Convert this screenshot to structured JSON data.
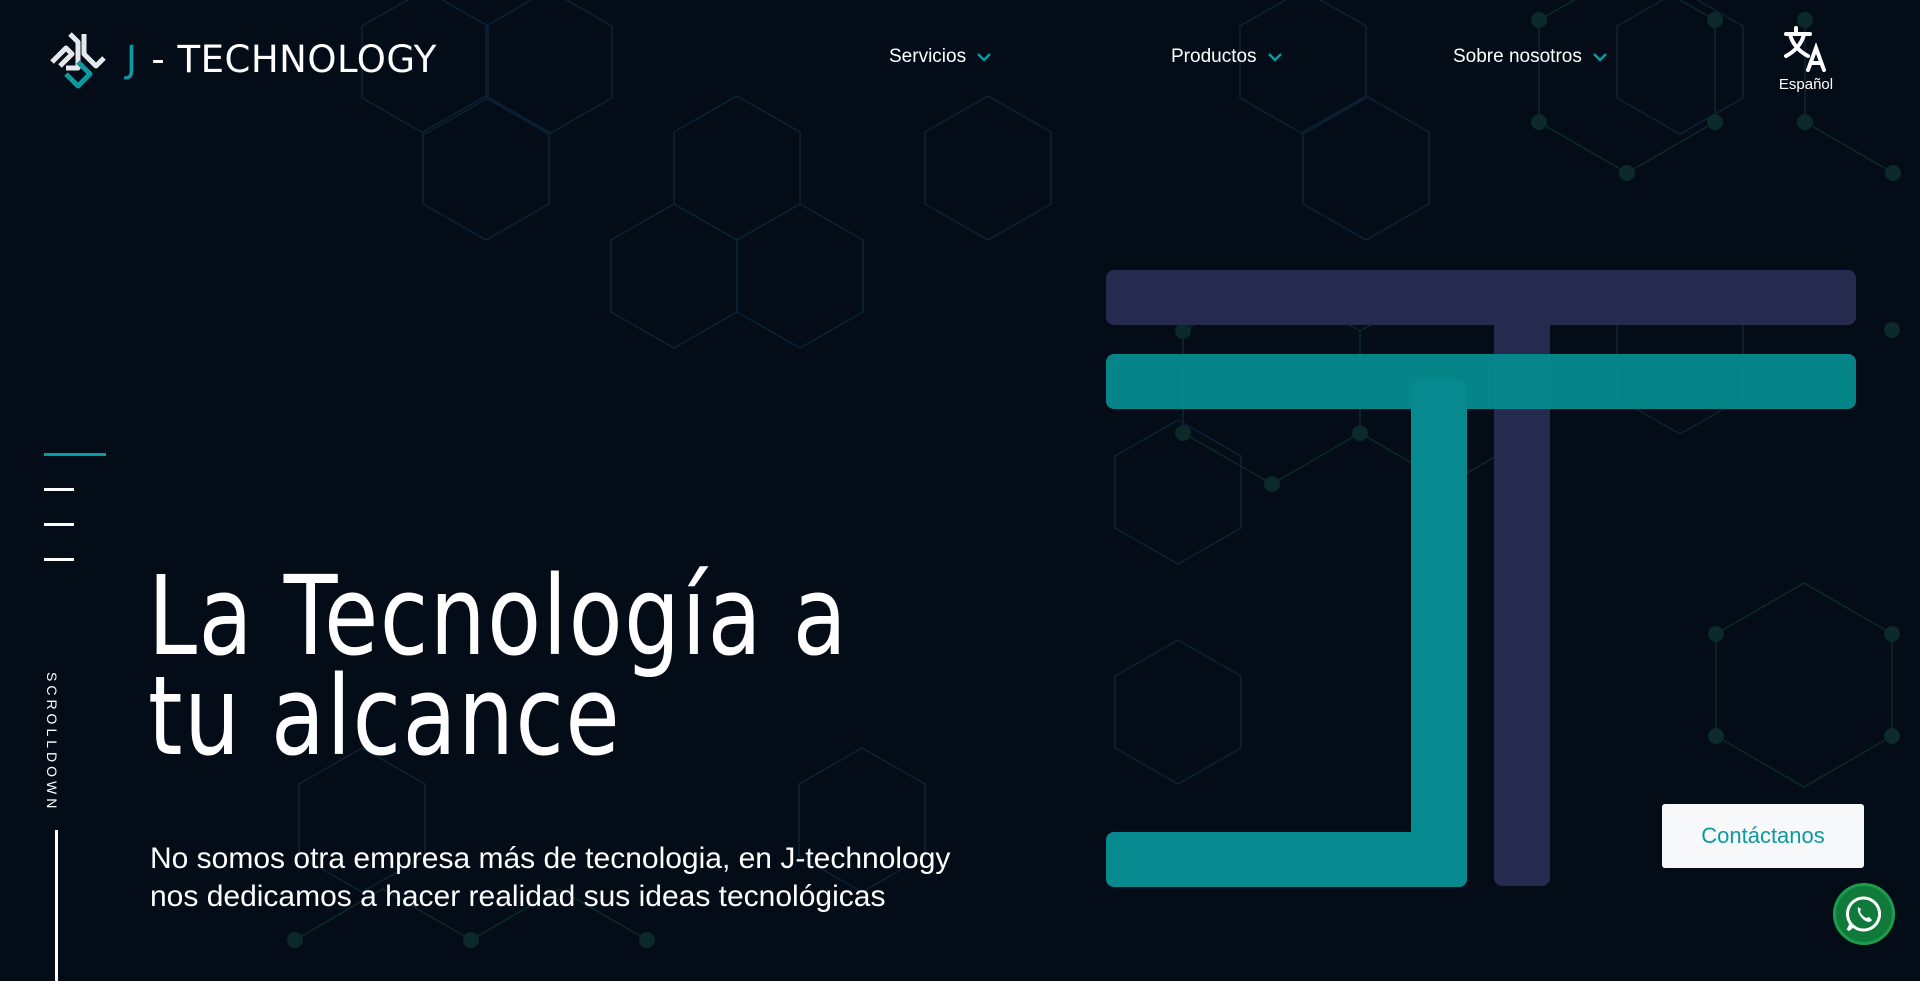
{
  "brand": {
    "letter": "J",
    "name": "- TECHNOLOGY",
    "accent_color": "#0b9aa0",
    "background_color": "#030c17"
  },
  "nav": {
    "items": [
      {
        "label": "Servicios",
        "icon": "chevron-down-icon"
      },
      {
        "label": "Productos",
        "icon": "chevron-down-icon"
      },
      {
        "label": "Sobre nosotros",
        "icon": "chevron-down-icon"
      }
    ]
  },
  "language": {
    "label": "Español",
    "icon": "translate-icon"
  },
  "side": {
    "scroll_label": "SCROLLDOWN",
    "active_slide": 1,
    "slide_count": 4
  },
  "hero": {
    "title_line1": "La Tecnología a",
    "title_line2": "tu alcance",
    "subtitle_line1": "No somos otra empresa más de tecnologia, en J-technology",
    "subtitle_line2": "nos dedicamos a hacer realidad sus ideas tecnológicas",
    "graphic_colors": {
      "teal": "#068a8f",
      "navy": "#252a4f"
    }
  },
  "contact": {
    "label": "Contáctanos"
  },
  "whatsapp": {
    "icon": "whatsapp-icon",
    "color": "#0f7a3a"
  }
}
